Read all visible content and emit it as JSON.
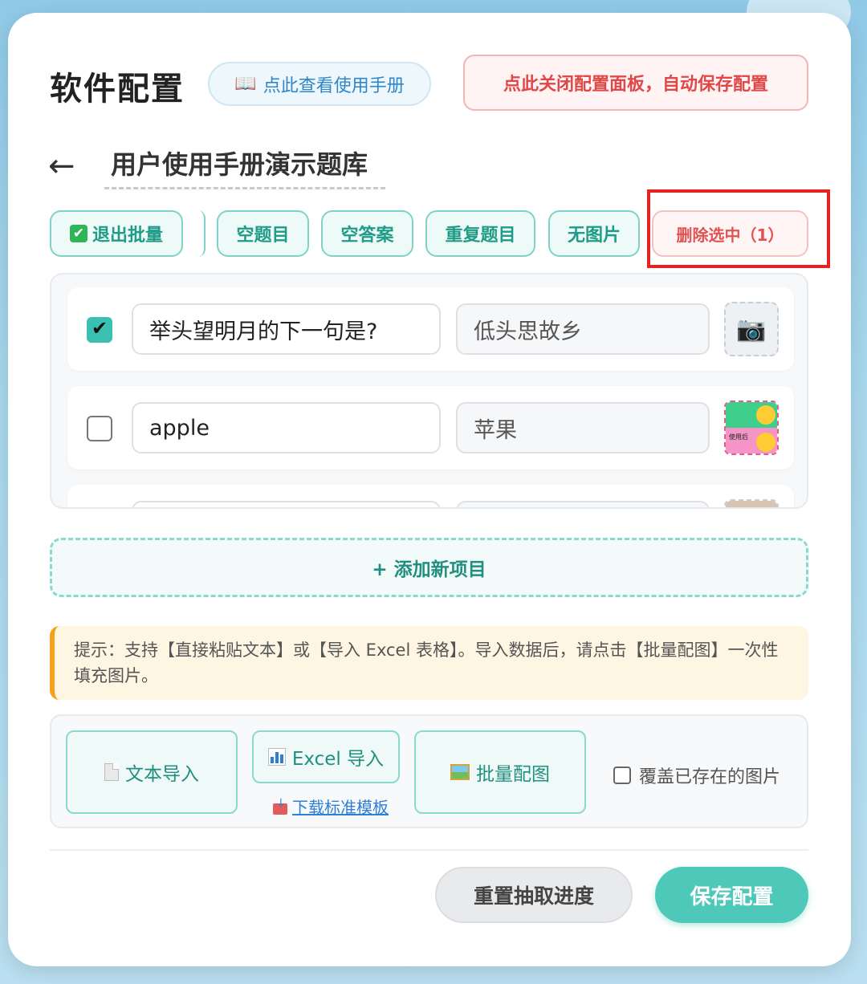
{
  "header": {
    "title": "软件配置",
    "manual_icon": "book-icon",
    "manual_label": "点此查看使用手册",
    "close_label": "点此关闭配置面板，自动保存配置"
  },
  "set": {
    "back_arrow": "←",
    "title": "用户使用手册演示题库"
  },
  "toolbar": {
    "exit_batch_label": "退出批量",
    "exit_batch_icon": "✔",
    "filters": [
      "空题目",
      "空答案",
      "重复题目",
      "无图片"
    ],
    "delete_selected_label": "删除选中（1）"
  },
  "items": [
    {
      "checked": true,
      "question": "举头望明月的下一句是?",
      "answer": "低头思故乡",
      "image": "camera-placeholder"
    },
    {
      "checked": false,
      "question": "apple",
      "answer": "苹果",
      "image": "thumbnail"
    },
    {
      "checked": false,
      "question": "",
      "answer": "",
      "image": "thumbnail"
    }
  ],
  "thumb_text": "使用后",
  "add_item_label": "+ 添加新项目",
  "tip": "提示：支持【直接粘贴文本】或【导入 Excel 表格】。导入数据后，请点击【批量配图】一次性填充图片。",
  "import": {
    "text_import_label": "文本导入",
    "excel_import_label": "Excel 导入",
    "download_template_label": "下载标准模板",
    "batch_image_label": "批量配图",
    "overwrite_label": "覆盖已存在的图片"
  },
  "footer": {
    "reset_label": "重置抽取进度",
    "save_label": "保存配置"
  },
  "colors": {
    "accent": "#4ec8b8",
    "danger": "#e04848",
    "highlight_box": "#e42222"
  }
}
